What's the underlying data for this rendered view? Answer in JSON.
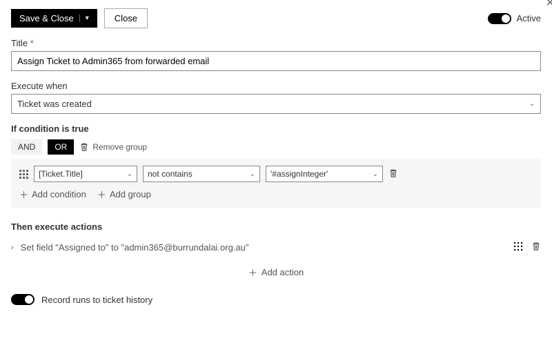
{
  "topbar": {
    "save_close": "Save & Close",
    "close": "Close",
    "active_label": "Active"
  },
  "title": {
    "label": "Title",
    "value": "Assign Ticket to Admin365 from forwarded email"
  },
  "execute_when": {
    "label": "Execute when",
    "value": "Ticket was created"
  },
  "condition": {
    "heading": "If condition is true",
    "and": "AND",
    "or": "OR",
    "remove_group": "Remove group",
    "row": {
      "field": "[Ticket.Title]",
      "operator": "not contains",
      "value": "'#assignInteger'"
    },
    "add_condition": "Add condition",
    "add_group": "Add group"
  },
  "actions": {
    "heading": "Then execute actions",
    "item": "Set field \"Assigned to\" to \"admin365@burrundalai.org.au\"",
    "add_action": "Add action"
  },
  "footer": {
    "record_runs": "Record runs to ticket history"
  }
}
